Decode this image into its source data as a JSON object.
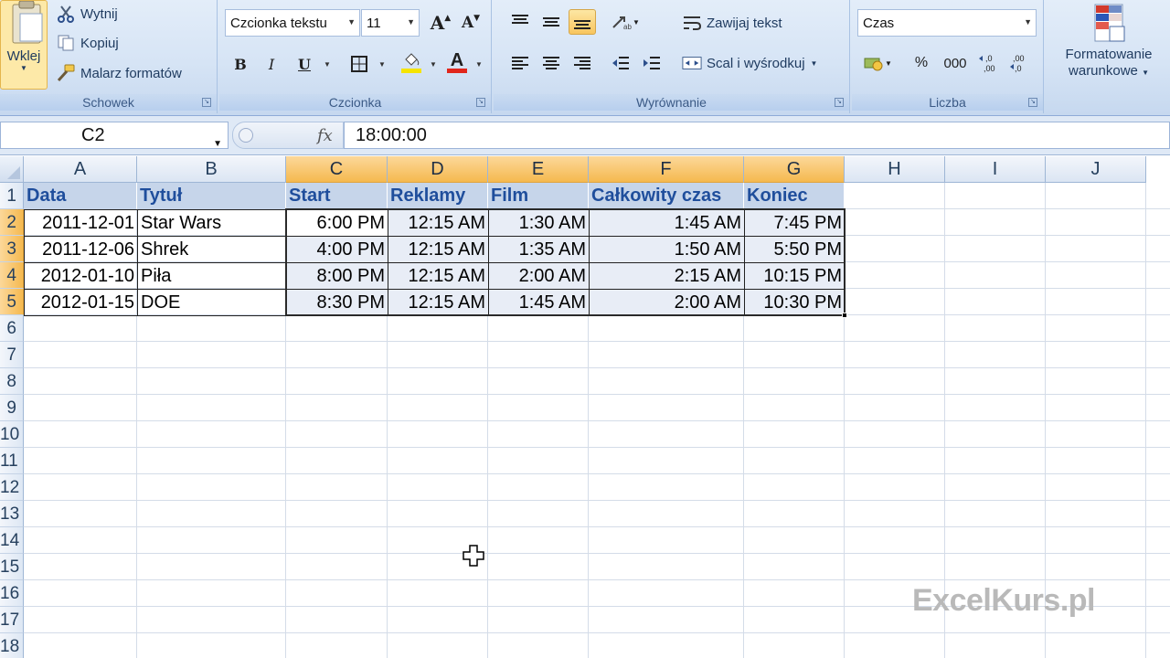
{
  "ribbon": {
    "clipboard": {
      "paste_label": "Wklej",
      "cut_label": "Wytnij",
      "copy_label": "Kopiuj",
      "format_painter_label": "Malarz formatów",
      "group_label": "Schowek"
    },
    "font": {
      "font_name": "Czcionka tekstu",
      "font_size": "11",
      "grow_label": "A",
      "shrink_label": "A",
      "bold_label": "B",
      "italic_label": "I",
      "underline_label": "U",
      "font_color_label": "A",
      "fill_color": "#f5e400",
      "font_color": "#e1261c",
      "group_label": "Czcionka"
    },
    "alignment": {
      "wrap_text_label": "Zawijaj tekst",
      "merge_center_label": "Scal i wyśrodkuj",
      "group_label": "Wyrównanie"
    },
    "number": {
      "format": "Czas",
      "percent_label": "%",
      "thousands_label": "000",
      "group_label": "Liczba"
    },
    "styles": {
      "conditional_line1": "Formatowanie",
      "conditional_line2": "warunkowe"
    }
  },
  "formula_bar": {
    "name_box": "C2",
    "fx_label": "fx",
    "formula": "18:00:00"
  },
  "grid": {
    "columns": [
      "A",
      "B",
      "C",
      "D",
      "E",
      "F",
      "G",
      "H",
      "I",
      "J"
    ],
    "selected_columns": [
      "C",
      "D",
      "E",
      "F",
      "G"
    ],
    "row_numbers": [
      "1",
      "2",
      "3",
      "4",
      "5",
      "6",
      "7",
      "8",
      "9",
      "10",
      "11",
      "12",
      "13",
      "14",
      "15",
      "16",
      "17",
      "18"
    ],
    "selected_rows": [
      "2",
      "3",
      "4",
      "5"
    ],
    "headers": [
      "Data",
      "Tytuł",
      "Start",
      "Reklamy",
      "Film",
      "Całkowity czas",
      "Koniec"
    ],
    "rows": [
      [
        "2011-12-01",
        "Star Wars",
        "6:00 PM",
        "12:15 AM",
        "1:30 AM",
        "1:45 AM",
        "7:45 PM"
      ],
      [
        "2011-12-06",
        "Shrek",
        "4:00 PM",
        "12:15 AM",
        "1:35 AM",
        "1:50 AM",
        "5:50 PM"
      ],
      [
        "2012-01-10",
        "Piła",
        "8:00 PM",
        "12:15 AM",
        "2:00 AM",
        "2:15 AM",
        "10:15 PM"
      ],
      [
        "2012-01-15",
        "DOE",
        "8:30 PM",
        "12:15 AM",
        "1:45 AM",
        "2:00 AM",
        "10:30 PM"
      ]
    ]
  },
  "watermark": "ExcelKurs.pl"
}
